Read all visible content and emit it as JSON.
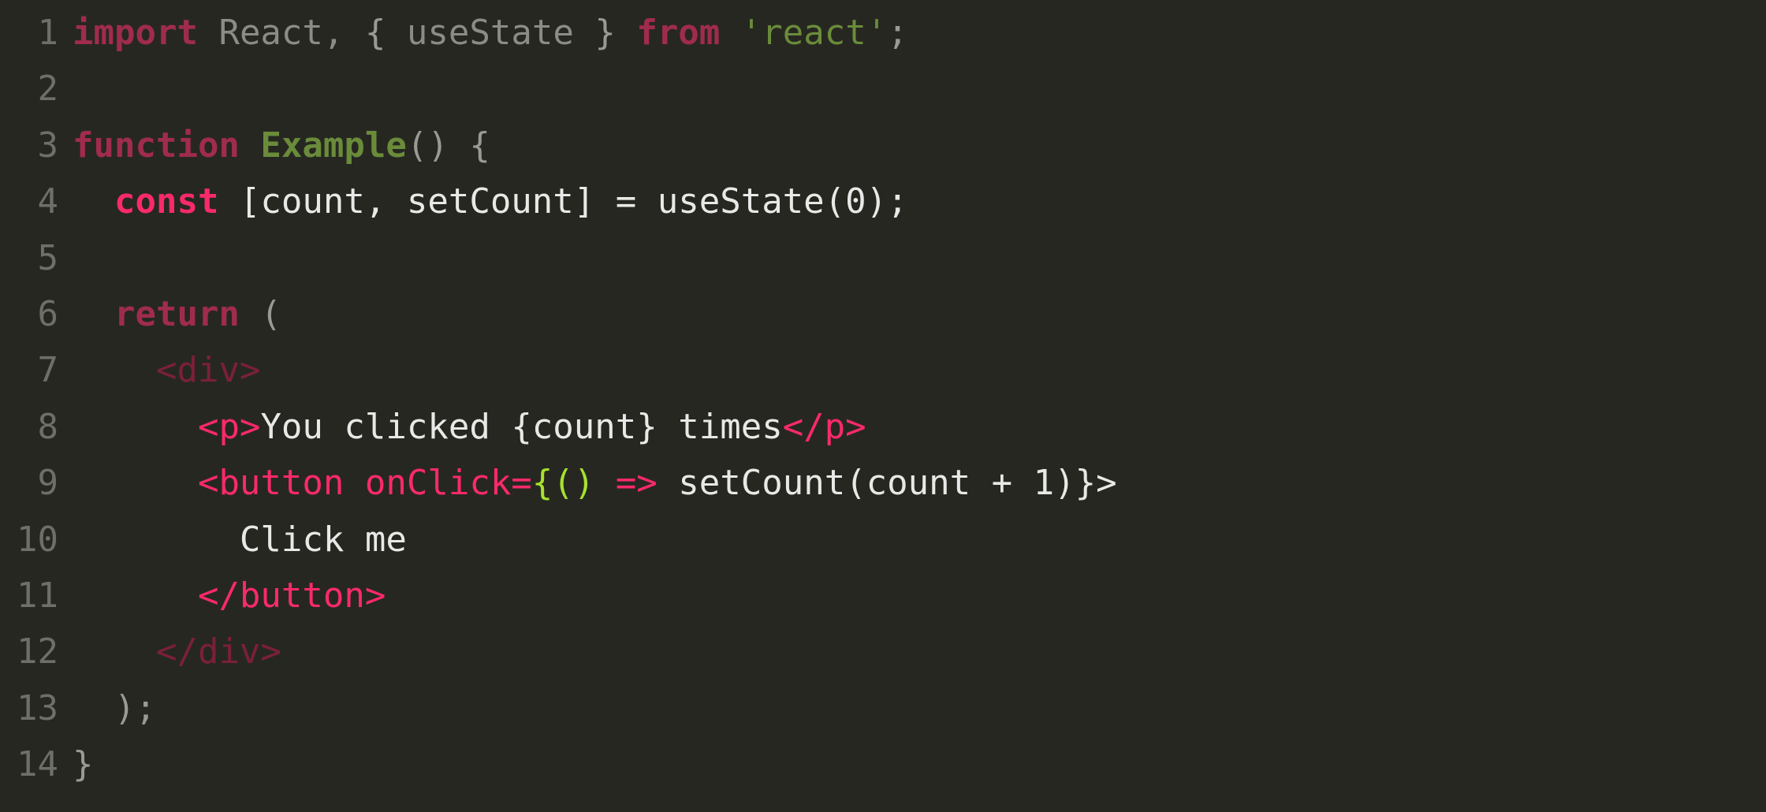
{
  "editor": {
    "background_color": "#272722",
    "gutter_color": "#6f6f69",
    "language": "jsx",
    "total_lines": 14
  },
  "palette": {
    "keyword_dim": "#a02c4c",
    "keyword_bright": "#fa2a6a",
    "function_name": "#6a8c3a",
    "string": "#6a8c3a",
    "plain_gray": "#8c8c86",
    "plain_white": "#e8e8e6",
    "punctuation": "#9a9a93",
    "tag_dim": "#7a2038",
    "tag_bright": "#fa2a6a",
    "lime": "#a6e22e"
  },
  "lines": [
    {
      "number": "1",
      "tokens": [
        {
          "text": "import",
          "kind": "keyword_dim"
        },
        {
          "text": " ",
          "kind": "space"
        },
        {
          "text": "React,",
          "kind": "plain_gray"
        },
        {
          "text": " ",
          "kind": "space"
        },
        {
          "text": "{",
          "kind": "punctuation"
        },
        {
          "text": " ",
          "kind": "space"
        },
        {
          "text": "useState",
          "kind": "plain_gray"
        },
        {
          "text": " ",
          "kind": "space"
        },
        {
          "text": "}",
          "kind": "punctuation"
        },
        {
          "text": " ",
          "kind": "space"
        },
        {
          "text": "from",
          "kind": "keyword_dim"
        },
        {
          "text": " ",
          "kind": "space"
        },
        {
          "text": "'react'",
          "kind": "string"
        },
        {
          "text": ";",
          "kind": "punctuation"
        }
      ]
    },
    {
      "number": "2",
      "tokens": []
    },
    {
      "number": "3",
      "tokens": [
        {
          "text": "function",
          "kind": "keyword_dim"
        },
        {
          "text": " ",
          "kind": "space"
        },
        {
          "text": "Example",
          "kind": "function_name"
        },
        {
          "text": "()",
          "kind": "punctuation"
        },
        {
          "text": " ",
          "kind": "space"
        },
        {
          "text": "{",
          "kind": "punctuation"
        }
      ]
    },
    {
      "number": "4",
      "tokens": [
        {
          "text": "  ",
          "kind": "space"
        },
        {
          "text": "const",
          "kind": "keyword_bright"
        },
        {
          "text": " ",
          "kind": "space"
        },
        {
          "text": "[count, setCount] = useState(0);",
          "kind": "plain_white"
        }
      ]
    },
    {
      "number": "5",
      "tokens": []
    },
    {
      "number": "6",
      "tokens": [
        {
          "text": "  ",
          "kind": "space"
        },
        {
          "text": "return",
          "kind": "keyword_dim"
        },
        {
          "text": " ",
          "kind": "space"
        },
        {
          "text": "(",
          "kind": "punctuation"
        }
      ]
    },
    {
      "number": "7",
      "tokens": [
        {
          "text": "    ",
          "kind": "space"
        },
        {
          "text": "<div>",
          "kind": "tag_dim"
        }
      ]
    },
    {
      "number": "8",
      "tokens": [
        {
          "text": "      ",
          "kind": "space"
        },
        {
          "text": "<p>",
          "kind": "tag_bright"
        },
        {
          "text": "You clicked {count} times",
          "kind": "plain_white"
        },
        {
          "text": "</p>",
          "kind": "tag_bright"
        }
      ]
    },
    {
      "number": "9",
      "tokens": [
        {
          "text": "      ",
          "kind": "space"
        },
        {
          "text": "<button onClick=",
          "kind": "tag_bright"
        },
        {
          "text": "{()",
          "kind": "lime"
        },
        {
          "text": " ",
          "kind": "space"
        },
        {
          "text": "=>",
          "kind": "tag_bright"
        },
        {
          "text": " ",
          "kind": "space"
        },
        {
          "text": "setCount(count + 1)}>",
          "kind": "plain_white"
        }
      ]
    },
    {
      "number": "10",
      "tokens": [
        {
          "text": "        ",
          "kind": "space"
        },
        {
          "text": "Click me",
          "kind": "plain_white"
        }
      ]
    },
    {
      "number": "11",
      "tokens": [
        {
          "text": "      ",
          "kind": "space"
        },
        {
          "text": "</button>",
          "kind": "tag_bright"
        }
      ]
    },
    {
      "number": "12",
      "tokens": [
        {
          "text": "    ",
          "kind": "space"
        },
        {
          "text": "</div>",
          "kind": "tag_dim"
        }
      ]
    },
    {
      "number": "13",
      "tokens": [
        {
          "text": "  ",
          "kind": "space"
        },
        {
          "text": ");",
          "kind": "punctuation"
        }
      ]
    },
    {
      "number": "14",
      "tokens": [
        {
          "text": "}",
          "kind": "punctuation"
        }
      ]
    }
  ]
}
